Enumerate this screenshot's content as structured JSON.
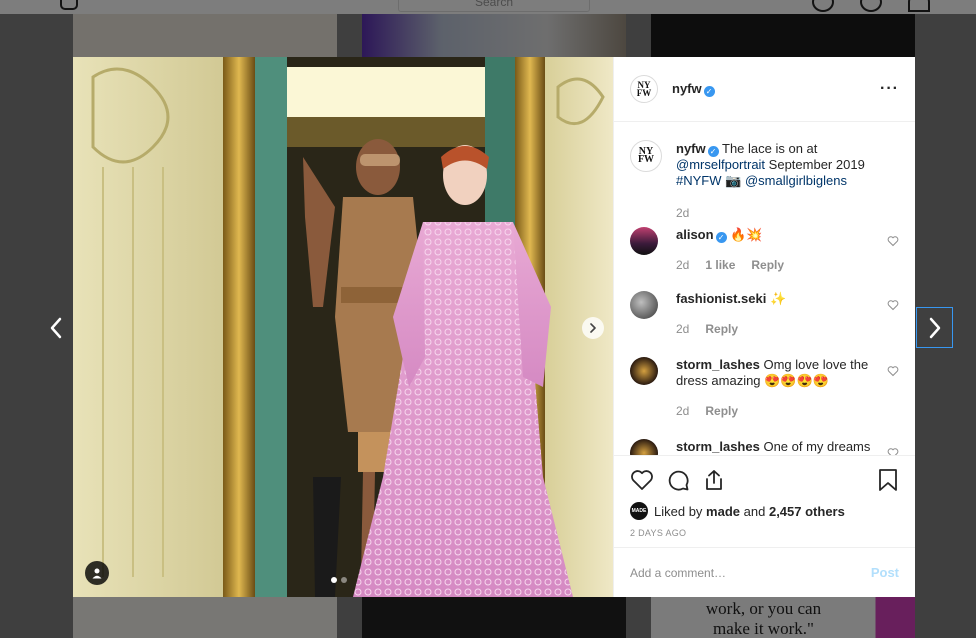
{
  "header": {
    "search_placeholder": "Search"
  },
  "bg": {
    "quote_line1": "work, or you can",
    "quote_line2": "make it work.\""
  },
  "post": {
    "username": "nyfw",
    "avatar_text": "NY FW",
    "more_icon": "more-horizontal-icon",
    "caption": {
      "text_1": "The lace is on at",
      "mention_1": "@mrselfportrait",
      "text_2": "September 2019",
      "hashtag": "#NYFW",
      "camera_emoji": "📷",
      "mention_2": "@smallgirlbiglens",
      "time": "2d"
    },
    "comments": [
      {
        "username": "alison",
        "verified": true,
        "text": "🔥💥",
        "time": "2d",
        "likes": "1 like",
        "reply": "Reply"
      },
      {
        "username": "fashionist.seki",
        "verified": false,
        "text": "✨",
        "time": "2d",
        "reply": "Reply"
      },
      {
        "username": "storm_lashes",
        "verified": false,
        "text": "Omg love love the dress amazing 😍😍😍😍",
        "time": "2d",
        "reply": "Reply"
      },
      {
        "username": "storm_lashes",
        "verified": false,
        "text": "One of my dreams"
      }
    ],
    "liked_by_prefix": "Liked by",
    "liked_by_user": "made",
    "liked_by_and": "and",
    "liked_by_others": "2,457 others",
    "likes_avatar_text": "MADE",
    "posted_time": "2 DAYS AGO",
    "comment_placeholder": "Add a comment…",
    "post_label": "Post"
  },
  "colors": {
    "verified": "#3897f0",
    "link": "#003569",
    "post_disabled": "#b2dffc",
    "nav_focus": "#3897f0"
  }
}
